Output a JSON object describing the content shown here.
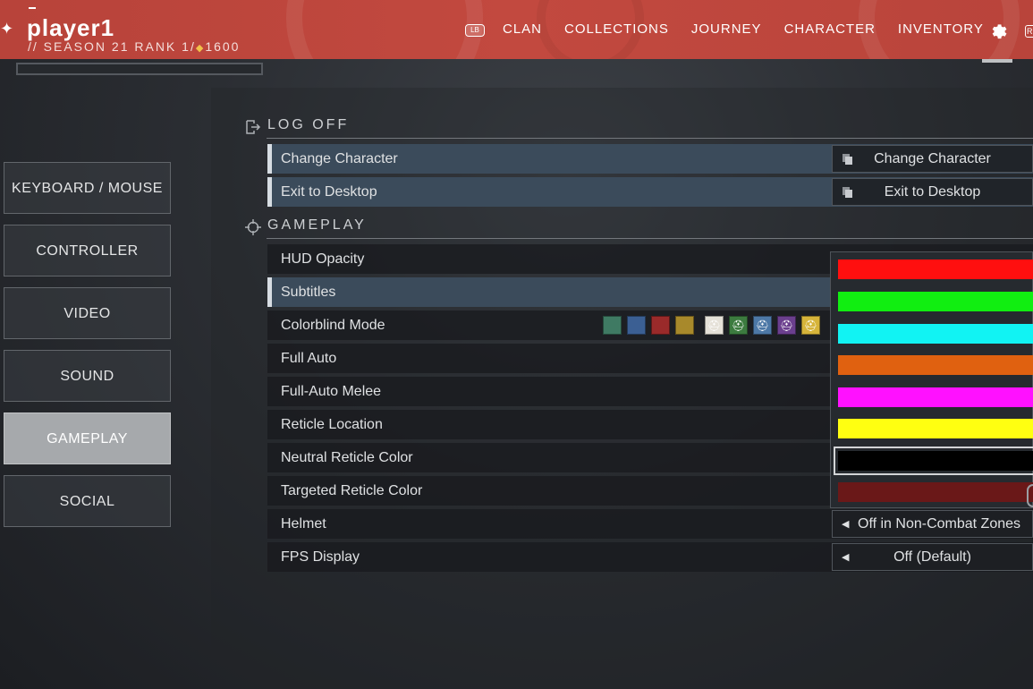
{
  "header": {
    "player_name": "player1",
    "rank_prefix": "// ",
    "season_rank": "SEASON 21 RANK 1/",
    "rank_points": "1600",
    "lb_badge": "LB",
    "rb_badge": "R",
    "nav_items": [
      "CLAN",
      "COLLECTIONS",
      "JOURNEY",
      "CHARACTER",
      "INVENTORY"
    ],
    "icons": {
      "settings": "gear-icon",
      "emblem": "ghost-emblem-icon"
    }
  },
  "left_menu": {
    "items": [
      {
        "label": "KEYBOARD / MOUSE",
        "active": false
      },
      {
        "label": "CONTROLLER",
        "active": false
      },
      {
        "label": "VIDEO",
        "active": false
      },
      {
        "label": "SOUND",
        "active": false
      },
      {
        "label": "GAMEPLAY",
        "active": true
      },
      {
        "label": "SOCIAL",
        "active": false
      }
    ]
  },
  "sections": {
    "logoff": {
      "title": "LOG OFF",
      "icon": "logout-icon",
      "rows": [
        {
          "label": "Change Character",
          "value": "Change Character"
        },
        {
          "label": "Exit to Desktop",
          "value": "Exit to Desktop"
        }
      ]
    },
    "gameplay": {
      "title": "GAMEPLAY",
      "icon": "crosshair-icon",
      "rows": [
        {
          "label": "HUD Opacity"
        },
        {
          "label": "Subtitles"
        },
        {
          "label": "Colorblind Mode"
        },
        {
          "label": "Full Auto"
        },
        {
          "label": "Full-Auto Melee"
        },
        {
          "label": "Reticle Location"
        },
        {
          "label": "Neutral Reticle Color"
        },
        {
          "label": "Targeted Reticle Color"
        },
        {
          "label": "Helmet",
          "value": "Off in Non-Combat Zones"
        },
        {
          "label": "FPS Display",
          "value": "Off (Default)"
        }
      ]
    }
  },
  "colorblind_swatches": [
    "#3f7a63",
    "#3b5f93",
    "#9a2a2a",
    "#a8892b",
    "#e5e1d8",
    "#3c7b3f",
    "#4d78a6",
    "#6b3f8e",
    "#d6b43a"
  ],
  "reticle_color_options": [
    "#ff0f0f",
    "#11ee11",
    "#11f3f3",
    "#e06110",
    "#ff11ff",
    "#ffff11",
    "#000000",
    "#6a1818"
  ],
  "selected_color_index": 6,
  "colors": {
    "topbar": "#c2493f",
    "row_highlight": "#3b4b5b",
    "active_menu": "#a6a9ac"
  }
}
